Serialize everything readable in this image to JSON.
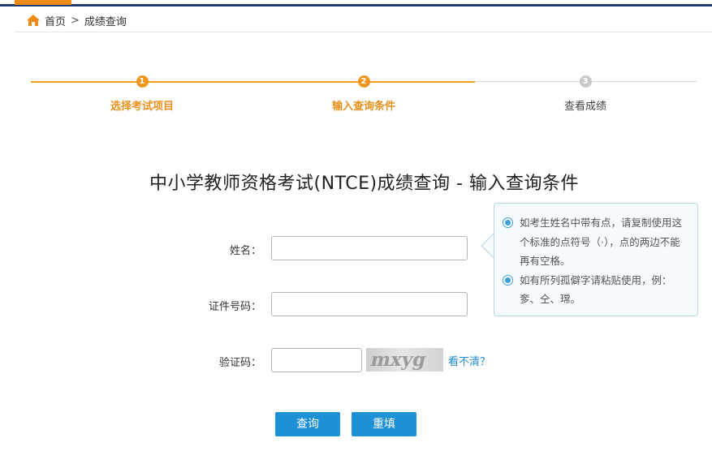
{
  "breadcrumb": {
    "home": "首页",
    "separator": ">",
    "current": "成绩查询",
    "home_icon": "home-icon",
    "icon_color": "#f08c14"
  },
  "steps": [
    {
      "number": "1",
      "label": "选择考试项目",
      "state": "done"
    },
    {
      "number": "2",
      "label": "输入查询条件",
      "state": "done"
    },
    {
      "number": "3",
      "label": "查看成绩",
      "state": "todo"
    }
  ],
  "page_title": "中小学教师资格考试(NTCE)成绩查询 - 输入查询条件",
  "form": {
    "name_label": "姓名：",
    "name_value": "",
    "id_label": "证件号码：",
    "id_value": "",
    "captcha_label": "验证码：",
    "captcha_value": "",
    "captcha_image_text": "mxyg",
    "refresh_link": "看不清？"
  },
  "tip": {
    "items": [
      "如考生姓名中带有点，请复制使用这个标准的点符号（·），点的两边不能再有空格。",
      "如有所列孤僻字请粘贴使用，例：奓、仝、瑺。"
    ]
  },
  "buttons": {
    "submit": "查询",
    "reset": "重填"
  },
  "colors": {
    "accent_orange": "#f08c14",
    "primary_blue": "#1e90d6",
    "navy": "#1f3c6e"
  }
}
